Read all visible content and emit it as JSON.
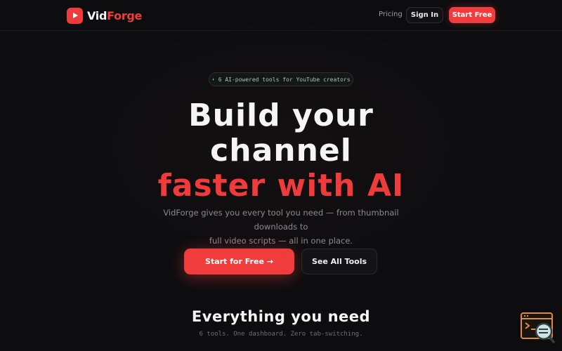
{
  "brand": {
    "name_part1": "Vid",
    "name_part2": "Forge",
    "accent": "#ef3b3b"
  },
  "nav": {
    "pricing": "Pricing",
    "sign_in": "Sign In",
    "start_free": "Start Free"
  },
  "hero": {
    "badge": "6 AI-powered tools for YouTube creators",
    "headline_line1": "Build your",
    "headline_line2": "channel",
    "headline_line3": "faster with AI",
    "subtitle_line1": "VidForge gives you every tool you need — from thumbnail downloads to",
    "subtitle_line2": "full video scripts — all in one place.",
    "cta_primary": "Start for Free →",
    "cta_secondary": "See All Tools"
  },
  "features": {
    "title": "Everything you need",
    "subtitle": "6 tools. One dashboard. Zero tab-switching."
  },
  "icons": [
    "play-icon",
    "sparkle-icon",
    "terminal-search-icon"
  ]
}
